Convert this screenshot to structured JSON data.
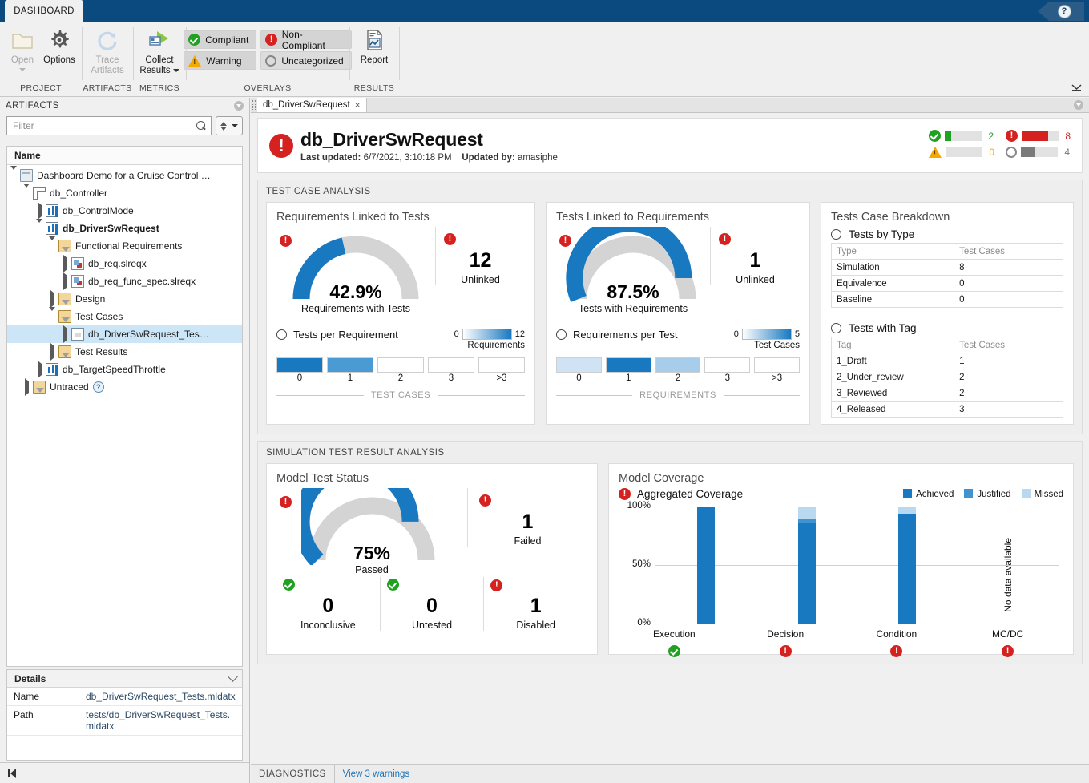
{
  "window": {
    "ribbon_tab": "DASHBOARD",
    "help_icon": "?"
  },
  "ribbon": {
    "groups": [
      {
        "label": "PROJECT",
        "buttons": [
          {
            "name": "open",
            "label": "Open",
            "icon": "folder-icon",
            "disabled": true,
            "has_caret": true
          },
          {
            "name": "options",
            "label": "Options",
            "icon": "gear-icon",
            "disabled": false,
            "has_caret": false
          }
        ]
      },
      {
        "label": "ARTIFACTS",
        "buttons": [
          {
            "name": "trace-artifacts",
            "label": "Trace\nArtifacts",
            "icon": "refresh-icon",
            "disabled": true,
            "has_caret": false
          }
        ]
      },
      {
        "label": "METRICS",
        "buttons": [
          {
            "name": "collect-results",
            "label": "Collect\nResults",
            "icon": "run-icon",
            "disabled": false,
            "has_caret": true
          }
        ]
      }
    ],
    "overlays_label": "OVERLAYS",
    "overlays": [
      {
        "label": "Compliant",
        "icon": "check-circle-icon",
        "status": "ok"
      },
      {
        "label": "Non-Compliant",
        "icon": "error-circle-icon",
        "status": "bad"
      },
      {
        "label": "Warning",
        "icon": "warning-triangle-icon",
        "status": "warn"
      },
      {
        "label": "Uncategorized",
        "icon": "empty-circle-icon",
        "status": "none"
      }
    ],
    "results_label": "RESULTS",
    "report_label": "Report",
    "trace_line1": "Trace",
    "trace_line2": "Artifacts",
    "collect_line1": "Collect",
    "collect_line2": "Results"
  },
  "artifacts_panel": {
    "title": "ARTIFACTS",
    "filter_placeholder": "Filter",
    "filter_value": "",
    "column_header": "Name",
    "tree": [
      {
        "depth": 0,
        "label": "Dashboard Demo for a Cruise Control …",
        "icon": "project-icon",
        "expander": "down",
        "selected": false,
        "bold": false
      },
      {
        "depth": 1,
        "label": "db_Controller",
        "icon": "subsystem-icon",
        "expander": "down",
        "selected": false,
        "bold": false
      },
      {
        "depth": 2,
        "label": "db_ControlMode",
        "icon": "model-icon",
        "expander": "right",
        "selected": false,
        "bold": false
      },
      {
        "depth": 2,
        "label": "db_DriverSwRequest",
        "icon": "model-icon",
        "expander": "down",
        "selected": false,
        "bold": true
      },
      {
        "depth": 3,
        "label": "Functional Requirements",
        "icon": "folder-icon",
        "expander": "down",
        "selected": false,
        "bold": false
      },
      {
        "depth": 4,
        "label": "db_req.slreqx",
        "icon": "requirement-icon",
        "expander": "right",
        "selected": false,
        "bold": false
      },
      {
        "depth": 4,
        "label": "db_req_func_spec.slreqx",
        "icon": "requirement-icon",
        "expander": "right",
        "selected": false,
        "bold": false
      },
      {
        "depth": 3,
        "label": "Design",
        "icon": "folder-icon",
        "expander": "right",
        "selected": false,
        "bold": false
      },
      {
        "depth": 3,
        "label": "Test Cases",
        "icon": "folder-icon",
        "expander": "down",
        "selected": false,
        "bold": false
      },
      {
        "depth": 4,
        "label": "db_DriverSwRequest_Tes…",
        "icon": "test-icon",
        "expander": "right",
        "selected": true,
        "bold": false
      },
      {
        "depth": 3,
        "label": "Test Results",
        "icon": "folder-icon",
        "expander": "right",
        "selected": false,
        "bold": false
      },
      {
        "depth": 2,
        "label": "db_TargetSpeedThrottle",
        "icon": "model-icon",
        "expander": "right",
        "selected": false,
        "bold": false
      },
      {
        "depth": 1,
        "label": "Untraced",
        "icon": "folder-icon",
        "expander": "right",
        "selected": false,
        "bold": false,
        "help": "?"
      }
    ]
  },
  "details_panel": {
    "title": "Details",
    "rows": [
      {
        "key": "Name",
        "value": "db_DriverSwRequest_Tests.mldatx"
      },
      {
        "key": "Path",
        "value": "tests/db_DriverSwRequest_Tests.mldatx"
      }
    ]
  },
  "doc_tabs": [
    {
      "label": "db_DriverSwRequest",
      "close": "×"
    }
  ],
  "header": {
    "status_icon": "error-circle-icon",
    "title": "db_DriverSwRequest",
    "last_updated_label": "Last updated:",
    "last_updated_value": "6/7/2021, 3:10:18 PM",
    "updated_by_label": "Updated by:",
    "updated_by_value": "amasiphe",
    "stats": [
      {
        "icon": "check-circle-icon",
        "status": "ok",
        "count": "2",
        "fill_pct": 18,
        "color": "#21a121"
      },
      {
        "icon": "error-circle-icon",
        "status": "bad",
        "count": "8",
        "fill_pct": 72,
        "color": "#d62121"
      },
      {
        "icon": "warning-triangle-icon",
        "status": "warn",
        "count": "0",
        "fill_pct": 0,
        "color": "#f5a800"
      },
      {
        "icon": "empty-circle-icon",
        "status": "none",
        "count": "4",
        "fill_pct": 36,
        "color": "#7a7a7a"
      }
    ]
  },
  "test_case_analysis": {
    "section_title": "TEST CASE ANALYSIS",
    "req_linked": {
      "card_title": "Requirements Linked to Tests",
      "gauge_value": "42.9%",
      "gauge_caption": "Requirements with Tests",
      "gauge_pct": 42.9,
      "gauge_flag": "error-circle-icon",
      "side_flag": "error-circle-icon",
      "side_number": "12",
      "side_caption": "Unlinked",
      "hist_label": "Tests per Requirement",
      "scale_min": "0",
      "scale_max": "12",
      "scale_caption": "Requirements",
      "axis_caption": "TEST CASES",
      "bins": [
        {
          "tick": "0",
          "fill": "#1878c0"
        },
        {
          "tick": "1",
          "fill": "#4a9bd4"
        },
        {
          "tick": "2",
          "fill": "#ffffff"
        },
        {
          "tick": "3",
          "fill": "#ffffff"
        },
        {
          "tick": ">3",
          "fill": "#ffffff"
        }
      ]
    },
    "tests_linked": {
      "card_title": "Tests Linked to Requirements",
      "gauge_value": "87.5%",
      "gauge_caption": "Tests with Requirements",
      "gauge_pct": 87.5,
      "gauge_flag": "error-circle-icon",
      "side_flag": "error-circle-icon",
      "side_number": "1",
      "side_caption": "Unlinked",
      "hist_label": "Requirements per Test",
      "scale_min": "0",
      "scale_max": "5",
      "scale_caption": "Test Cases",
      "axis_caption": "REQUIREMENTS",
      "bins": [
        {
          "tick": "0",
          "fill": "#cfe3f5"
        },
        {
          "tick": "1",
          "fill": "#1878c0"
        },
        {
          "tick": "2",
          "fill": "#a8cdea"
        },
        {
          "tick": "3",
          "fill": "#ffffff"
        },
        {
          "tick": ">3",
          "fill": "#ffffff"
        }
      ]
    },
    "breakdown": {
      "card_title": "Tests Case Breakdown",
      "by_type_label": "Tests by Type",
      "by_type_headers": [
        "Type",
        "Test Cases"
      ],
      "by_type_rows": [
        [
          "Simulation",
          "8"
        ],
        [
          "Equivalence",
          "0"
        ],
        [
          "Baseline",
          "0"
        ]
      ],
      "with_tag_label": "Tests with Tag",
      "with_tag_headers": [
        "Tag",
        "Test Cases"
      ],
      "with_tag_rows": [
        [
          "1_Draft",
          "1"
        ],
        [
          "2_Under_review",
          "2"
        ],
        [
          "3_Reviewed",
          "2"
        ],
        [
          "4_Released",
          "3"
        ]
      ]
    }
  },
  "simulation_analysis": {
    "section_title": "SIMULATION TEST RESULT ANALYSIS",
    "model_test_status": {
      "card_title": "Model Test Status",
      "gauge_value": "75%",
      "gauge_caption": "Passed",
      "gauge_pct": 75,
      "gauge_flag": "error-circle-icon",
      "side_flag": "error-circle-icon",
      "side_number": "1",
      "side_caption": "Failed",
      "bottom_cells": [
        {
          "flag": "check-circle-icon",
          "status": "ok",
          "number": "0",
          "caption": "Inconclusive"
        },
        {
          "flag": "check-circle-icon",
          "status": "ok",
          "number": "0",
          "caption": "Untested"
        },
        {
          "flag": "error-circle-icon",
          "status": "bad",
          "number": "1",
          "caption": "Disabled"
        }
      ]
    },
    "model_coverage": {
      "card_title": "Model Coverage",
      "aggregated_label": "Aggregated Coverage",
      "aggregated_flag": "error-circle-icon",
      "no_data_text": "No data available"
    }
  },
  "chart_data": {
    "type": "bar",
    "title": "Aggregated Coverage",
    "subtitle": "Model Coverage",
    "stacked": true,
    "categories": [
      "Execution",
      "Decision",
      "Condition",
      "MC/DC"
    ],
    "xlabel": "",
    "ylabel": "",
    "ylim": [
      0,
      100
    ],
    "ytick_labels": [
      "0%",
      "50%",
      "100%"
    ],
    "ytick_values": [
      0,
      50,
      100
    ],
    "grid": true,
    "legend_position": "top-right",
    "series": [
      {
        "name": "Achieved",
        "color": "#1878c0",
        "values": [
          100,
          86,
          94,
          null
        ]
      },
      {
        "name": "Justified",
        "color": "#3f93cf",
        "values": [
          0,
          4,
          0,
          null
        ]
      },
      {
        "name": "Missed",
        "color": "#b9d9f0",
        "values": [
          0,
          10,
          6,
          null
        ]
      }
    ],
    "category_status": [
      "ok",
      "bad",
      "bad",
      "bad"
    ],
    "no_data_categories": [
      "MC/DC"
    ],
    "annotations": [
      "No data available"
    ]
  },
  "diagnostics": {
    "label": "DIAGNOSTICS",
    "link": "View 3 warnings"
  }
}
